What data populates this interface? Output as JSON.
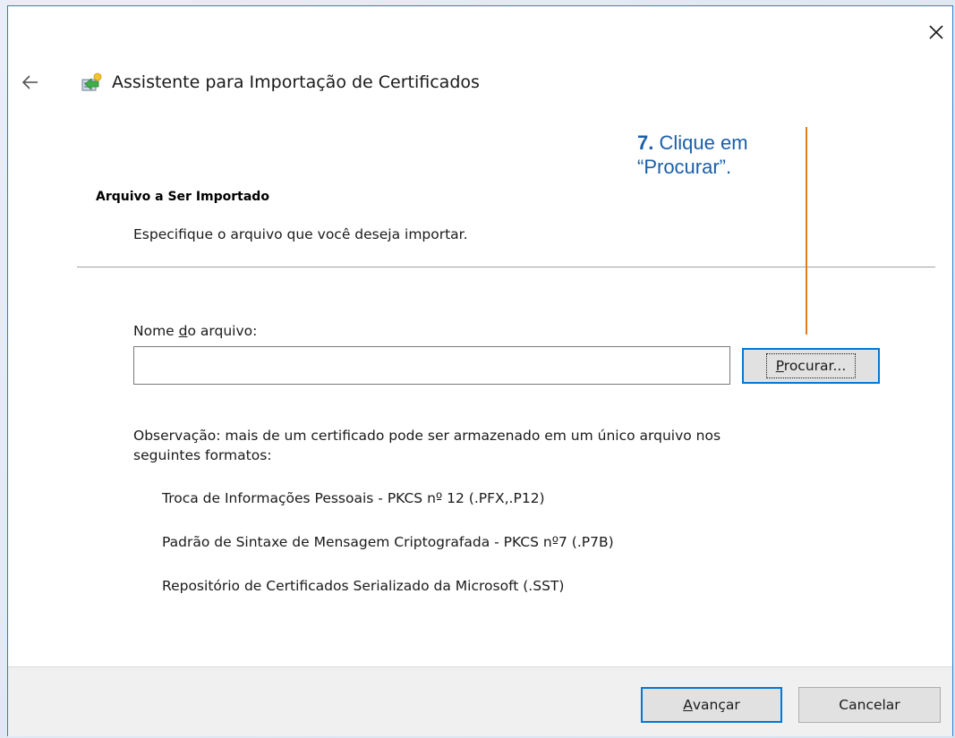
{
  "window": {
    "close_symbol": "✕",
    "back_symbol": "←",
    "icon": "certificate-wizard-icon"
  },
  "header": {
    "title": "Assistente para Importação de Certificados"
  },
  "section": {
    "title": "Arquivo a Ser Importado",
    "description": "Especifique o arquivo que você deseja importar."
  },
  "file": {
    "label_before": "Nome ",
    "label_accel": "d",
    "label_after": "o arquivo:",
    "value": "",
    "browse_accel": "P",
    "browse_rest": "rocurar..."
  },
  "note": {
    "text": "Observação: mais de um certificado pode ser armazenado em um único arquivo nos seguintes formatos:"
  },
  "formats": [
    "Troca de Informações Pessoais - PKCS nº 12 (.PFX,.P12)",
    "Padrão de Sintaxe de Mensagem Criptografada - PKCS nº7 (.P7B)",
    "Repositório de Certificados Serializado da Microsoft (.SST)"
  ],
  "footer": {
    "next_accel": "A",
    "next_rest": "vançar",
    "cancel_label": "Cancelar"
  },
  "callout": {
    "step": "7.",
    "line1": " Clique em",
    "line2": "“Procurar”."
  },
  "colors": {
    "accent": "#0078d7",
    "callout_text": "#1a5fa8",
    "callout_line": "#e07b1f",
    "window_border": "#2f7fcf"
  }
}
